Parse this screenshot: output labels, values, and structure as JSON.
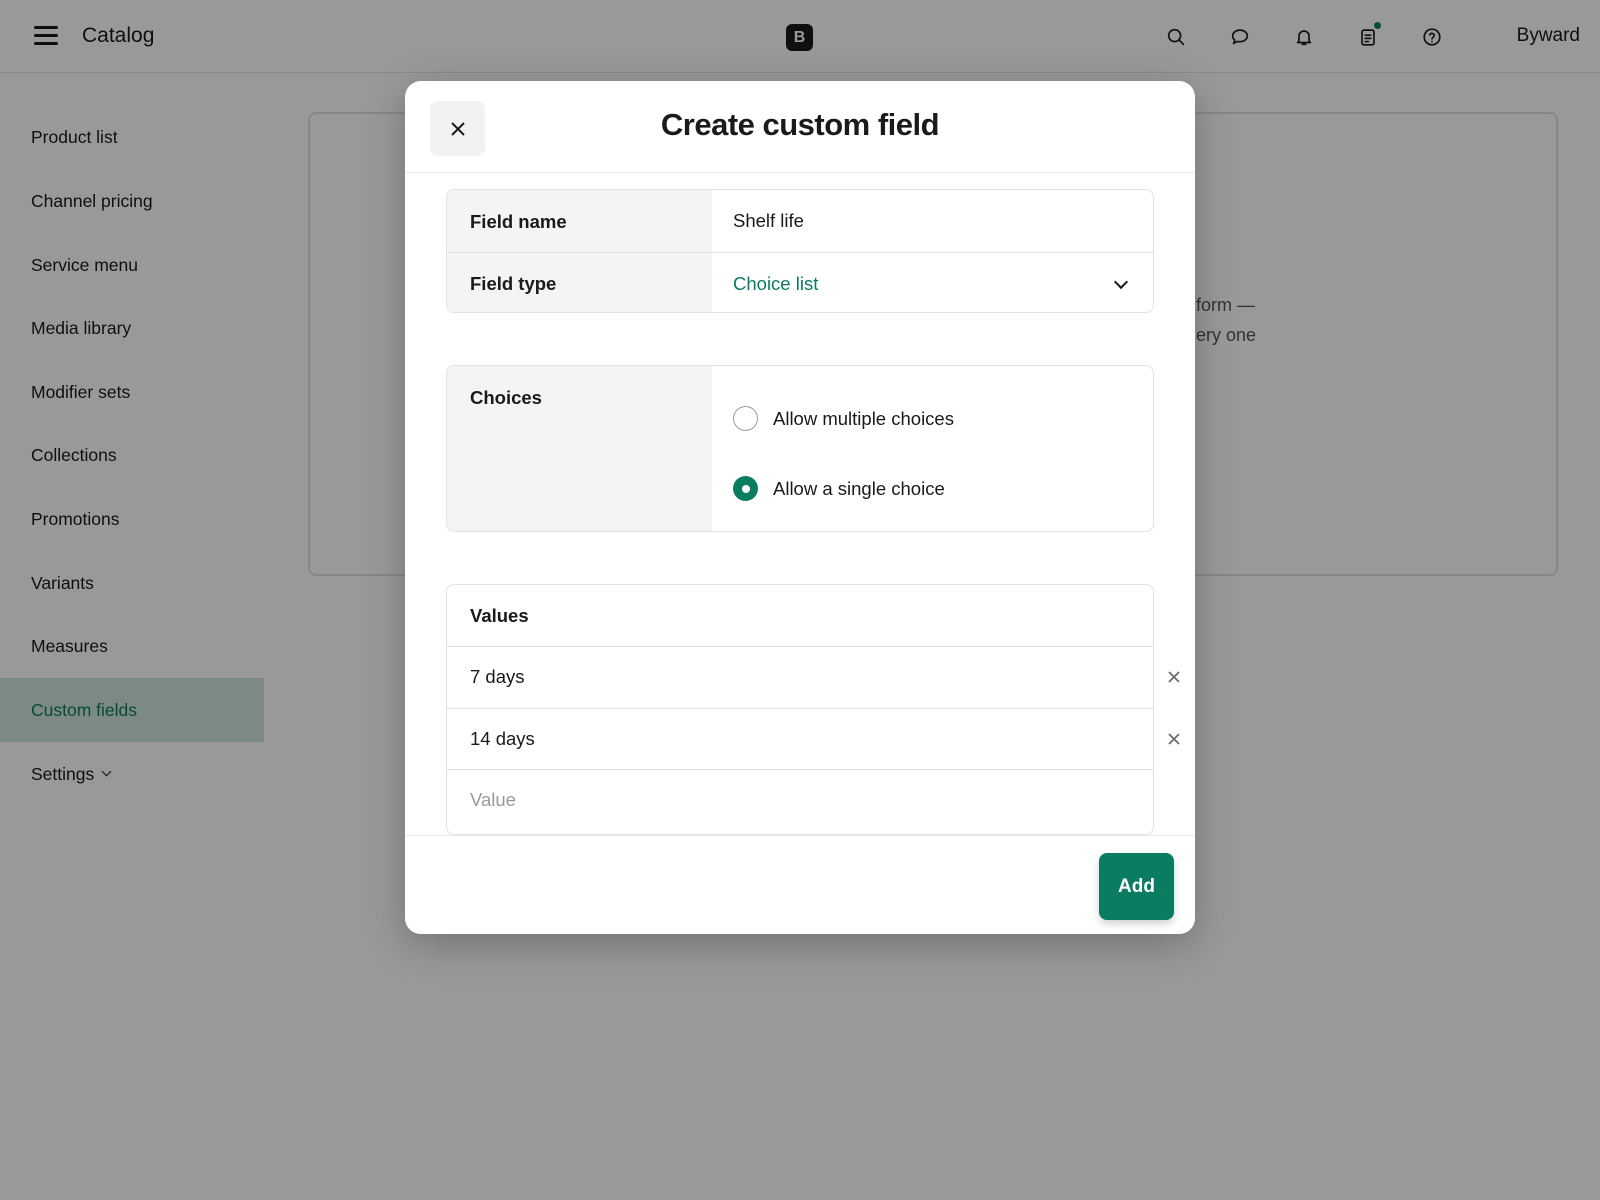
{
  "header": {
    "menu_icon": "hamburger-menu-icon",
    "title": "Catalog",
    "brand_letter": "B",
    "icons": [
      "search-icon",
      "chat-bubble-icon",
      "bell-icon",
      "clipboard-icon",
      "help-circle-icon"
    ],
    "account_name": "Byward"
  },
  "sidebar": {
    "items": [
      {
        "label": "Product list"
      },
      {
        "label": "Channel pricing"
      },
      {
        "label": "Service menu"
      },
      {
        "label": "Media library"
      },
      {
        "label": "Modifier sets"
      },
      {
        "label": "Collections"
      },
      {
        "label": "Promotions"
      },
      {
        "label": "Variants"
      },
      {
        "label": "Measures"
      },
      {
        "label": "Custom fields",
        "active": true
      },
      {
        "label": "Settings",
        "has_chevron": true
      }
    ]
  },
  "background_card": {
    "partial_text": "form —\nery one"
  },
  "modal": {
    "title": "Create custom field",
    "close_icon": "close-icon",
    "field_name": {
      "label": "Field name",
      "value": "Shelf life"
    },
    "field_type": {
      "label": "Field type",
      "value": "Choice list"
    },
    "choices": {
      "label": "Choices",
      "options": [
        {
          "label": "Allow multiple choices",
          "selected": false
        },
        {
          "label": "Allow a single choice",
          "selected": true
        }
      ]
    },
    "values": {
      "label": "Values",
      "items": [
        "7 days",
        "14 days"
      ],
      "new_value_placeholder": "Value"
    },
    "add_button": "Add"
  },
  "colors": {
    "accent": "#0a7c62",
    "active_nav_bg": "#cfe6db",
    "overlay": "rgba(0,0,0,0.40)"
  }
}
